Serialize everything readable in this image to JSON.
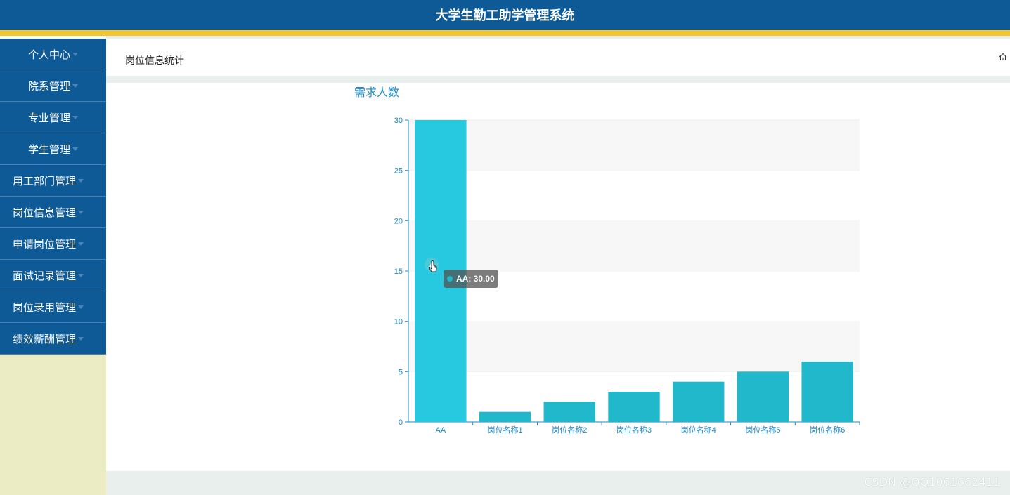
{
  "app": {
    "title": "大学生勤工助学管理系统"
  },
  "sidebar": {
    "items": [
      {
        "label": "个人中心"
      },
      {
        "label": "院系管理"
      },
      {
        "label": "专业管理"
      },
      {
        "label": "学生管理"
      },
      {
        "label": "用工部门管理"
      },
      {
        "label": "岗位信息管理"
      },
      {
        "label": "申请岗位管理"
      },
      {
        "label": "面试记录管理"
      },
      {
        "label": "岗位录用管理"
      },
      {
        "label": "绩效薪酬管理"
      }
    ]
  },
  "header": {
    "page_title": "岗位信息统计",
    "home_icon": "home-icon"
  },
  "colors": {
    "primary": "#0e5a96",
    "accent": "#f3c62f",
    "bar": "#22b8cb",
    "bar_highlight": "#26c9df",
    "axis": "#1a8ac9"
  },
  "chart_data": {
    "type": "bar",
    "title": "需求人数",
    "categories": [
      "AA",
      "岗位名称1",
      "岗位名称2",
      "岗位名称3",
      "岗位名称4",
      "岗位名称5",
      "岗位名称6"
    ],
    "values": [
      30,
      1,
      2,
      3,
      4,
      5,
      6
    ],
    "ylim": [
      0,
      30
    ],
    "yticks": [
      0,
      5,
      10,
      15,
      20,
      25,
      30
    ],
    "split_area": true,
    "tooltip": {
      "text": "AA: 30.00"
    }
  },
  "watermark": "CSDN @QQ1061662411"
}
